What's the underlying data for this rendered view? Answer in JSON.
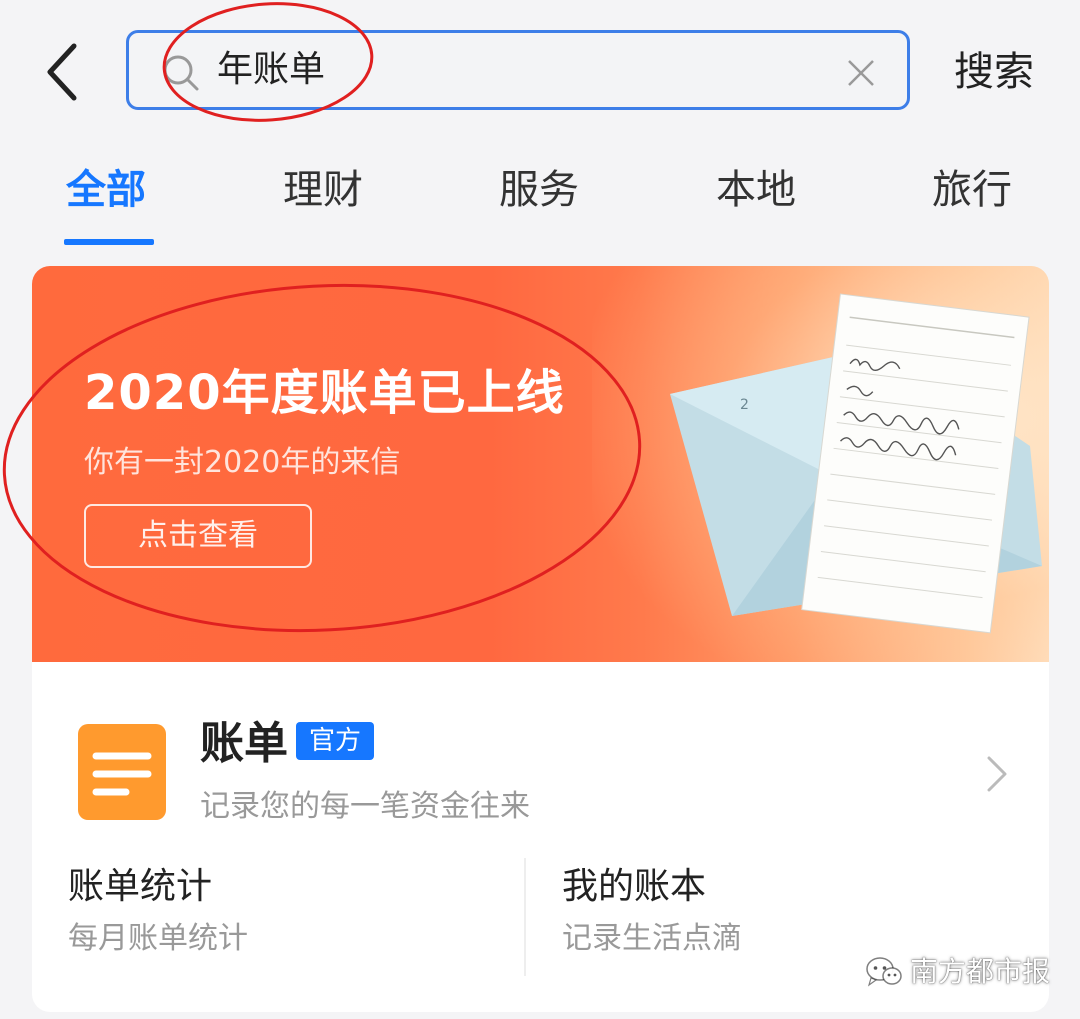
{
  "header": {
    "back_icon": "chevron-left-icon",
    "search": {
      "query": "年账单",
      "icon": "search-icon",
      "clear_icon": "close-icon"
    },
    "search_button_label": "搜索"
  },
  "tabs": {
    "items": [
      {
        "label": "全部",
        "active": true
      },
      {
        "label": "理财",
        "active": false
      },
      {
        "label": "服务",
        "active": false
      },
      {
        "label": "本地",
        "active": false
      },
      {
        "label": "旅行",
        "active": false
      }
    ]
  },
  "banner": {
    "title": "2020年度账单已上线",
    "subtitle": "你有一封2020年的来信",
    "cta_label": "点击查看",
    "illustration": "envelope-letter-illustration"
  },
  "result": {
    "app_icon": "bill-document-icon",
    "app_name": "账单",
    "badge": "官方",
    "description": "记录您的每一笔资金往来",
    "chevron_icon": "chevron-right-icon",
    "shortcuts": [
      {
        "title": "账单统计",
        "description": "每月账单统计"
      },
      {
        "title": "我的账本",
        "description": "记录生活点滴"
      }
    ]
  },
  "watermark": {
    "text": "南方都市报",
    "logo_icon": "wechat-logo-icon"
  },
  "colors": {
    "accent": "#1677ff",
    "banner": "#ff6a3d",
    "app_icon": "#ff9a2e",
    "annotation": "#e02020"
  }
}
